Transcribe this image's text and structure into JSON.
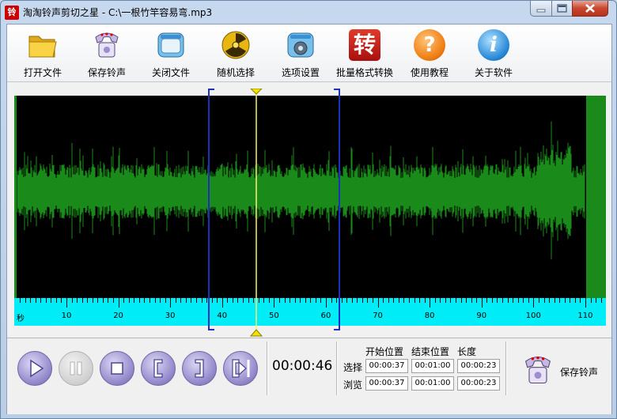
{
  "window": {
    "app_icon_char": "铃",
    "title": "淘淘铃声剪切之星 - C:\\一根竹竿容易弯.mp3"
  },
  "toolbar": {
    "items": [
      {
        "label": "打开文件",
        "icon": "folder-icon"
      },
      {
        "label": "保存铃声",
        "icon": "phone-save-icon"
      },
      {
        "label": "关闭文件",
        "icon": "close-file-icon"
      },
      {
        "label": "随机选择",
        "icon": "radiation-icon"
      },
      {
        "label": "选项设置",
        "icon": "gear-settings-icon"
      },
      {
        "label": "批量格式转换",
        "icon": "convert-icon",
        "glyph": "转"
      },
      {
        "label": "使用教程",
        "icon": "help-icon",
        "glyph": "?"
      },
      {
        "label": "关于软件",
        "icon": "info-icon",
        "glyph": "i"
      }
    ]
  },
  "waveform": {
    "color": "#1a8a1a",
    "background": "#000000",
    "duration_seconds": 113,
    "selection_start_seconds": 37,
    "selection_end_seconds": 60,
    "cursor_seconds": 46,
    "cursor_color": "#f4f46c"
  },
  "ruler": {
    "unit_label": "秒",
    "labels": [
      "10",
      "20",
      "30",
      "40",
      "50",
      "60",
      "70",
      "80",
      "90",
      "100",
      "110"
    ],
    "color": "#00ecf7"
  },
  "controls": {
    "buttons": [
      {
        "name": "play-button",
        "icon": "play-icon",
        "enabled": true
      },
      {
        "name": "pause-button",
        "icon": "pause-icon",
        "enabled": false
      },
      {
        "name": "stop-button",
        "icon": "stop-icon",
        "enabled": true
      },
      {
        "name": "set-start-button",
        "icon": "bracket-left-icon",
        "enabled": true
      },
      {
        "name": "set-end-button",
        "icon": "bracket-right-icon",
        "enabled": true
      },
      {
        "name": "play-to-end-button",
        "icon": "skip-end-icon",
        "enabled": true
      }
    ],
    "current_time": "00:00:46"
  },
  "times": {
    "headers": {
      "start": "开始位置",
      "end": "结束位置",
      "length": "长度"
    },
    "select": {
      "label": "选择",
      "start": "00:00:37",
      "end": "00:01:00",
      "length": "00:00:23"
    },
    "browse": {
      "label": "浏览",
      "start": "00:00:37",
      "end": "00:01:00",
      "length": "00:00:23"
    }
  },
  "save_button": {
    "label": "保存铃声"
  }
}
